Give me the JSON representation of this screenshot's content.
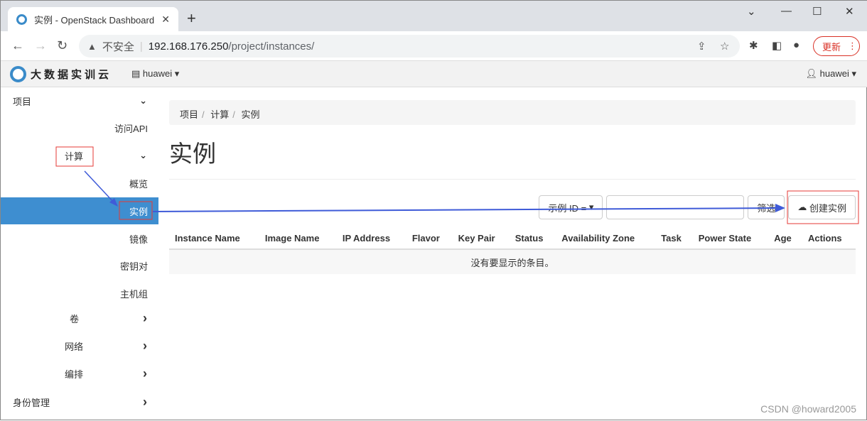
{
  "browser": {
    "tab_title": "实例 - OpenStack Dashboard",
    "insecure": "不安全",
    "host": "192.168.176.250",
    "path": "/project/instances/",
    "update": "更新"
  },
  "header": {
    "logo": "大数据实训云",
    "project": "huawei",
    "user": "huawei"
  },
  "sidebar": {
    "items": [
      {
        "label": "项目",
        "chev": "⌄"
      },
      {
        "label": "访问API"
      },
      {
        "label": "计算",
        "chev": "⌄"
      },
      {
        "label": "概览"
      },
      {
        "label": "实例",
        "active": true
      },
      {
        "label": "镜像"
      },
      {
        "label": "密钥对"
      },
      {
        "label": "主机组"
      },
      {
        "label": "卷",
        "chev": "›"
      },
      {
        "label": "网络",
        "chev": "›"
      },
      {
        "label": "编排",
        "chev": "›"
      },
      {
        "label": "身份管理",
        "chev": "›"
      }
    ]
  },
  "main": {
    "breadcrumb": [
      "项目",
      "计算",
      "实例"
    ],
    "title": "实例",
    "filter_select": "示例 ID =",
    "filter_value": "",
    "filter_button": "筛选",
    "create_button": "创建实例",
    "columns": [
      "Instance Name",
      "Image Name",
      "IP Address",
      "Flavor",
      "Key Pair",
      "Status",
      "Availability Zone",
      "Task",
      "Power State",
      "Age",
      "Actions"
    ],
    "empty": "没有要显示的条目。"
  },
  "watermark": "CSDN @howard2005",
  "colors": {
    "accent": "#3e8ed0",
    "annotation_red": "#e53935",
    "annotation_arrow": "#3f5bd8"
  }
}
